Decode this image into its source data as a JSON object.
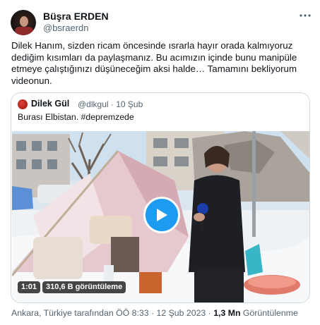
{
  "author": {
    "name": "Büşra ERDEN",
    "handle": "@bsraerdn",
    "avatar_icon": "profile-photo"
  },
  "more_icon": "more-horizontal-icon",
  "tweet_text": "Dilek Hanım, sizden ricam öncesinde ısrarla hayır orada kalmıyoruz dediğim kısımları da paylaşmanız. Bu acımızın içinde bunu manipüle etmeye çalıştığınızı düşüneceğim aksi halde… Tamamını bekliyorum videonun.",
  "quoted": {
    "name": "Dilek Gül",
    "handle": "@dlkgul",
    "separator": "·",
    "date": "10 Şub",
    "text": "Burası Elbistan. #depremzede",
    "video": {
      "duration": "1:01",
      "views": "310,6 B görüntüleme",
      "play_icon": "play-icon"
    }
  },
  "footer": {
    "location_time": "Ankara, Türkiye tarafından ÖÖ 8:33 · 12 Şub 2023 · ",
    "views_count": "1,3 Mn",
    "views_label": " Görüntülenme"
  },
  "colors": {
    "accent": "#1d9bf0",
    "text": "#0f1419",
    "muted": "#536471",
    "border": "#cfd9de"
  }
}
